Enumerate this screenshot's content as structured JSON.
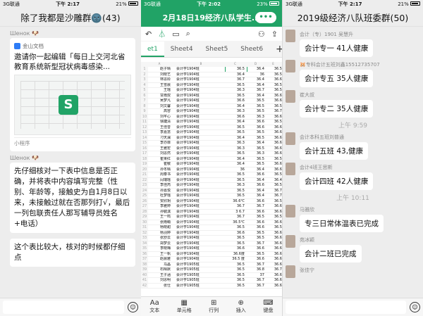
{
  "p1": {
    "status": {
      "left": "3G联通",
      "time": "下午 2:17",
      "battery": "21%"
    },
    "title": "除了我都是沙雕群🌚(43)",
    "m1": {
      "sender": "Шенок 🐶",
      "src": "金山文档",
      "ctitle": "邀请你一起编辑「每日上交河北省教育系统新型冠状病毒感染...",
      "mini": "小程序"
    },
    "m2": {
      "sender": "Шенок 🐶",
      "text": "先仔细核对一下表中信息是否正确，并将表中内容填写完整（性别、年龄等，接触史为自1月8日以来，未接触过就在否那列打√，最后一列包联责任人那写辅导员姓名+电话）"
    },
    "m3": {
      "text": "这个表比较大，核对的时候都仔细点"
    }
  },
  "p2": {
    "status": {
      "left": "3G联通",
      "time": "下午 2:02",
      "battery": "23%"
    },
    "title": "2月18日19经济八队学生...",
    "more": "•••",
    "tabs": [
      "et1",
      "Sheet4",
      "Sheet5",
      "Sheet6",
      "+"
    ],
    "cols": [
      "",
      "A",
      "B",
      "C",
      "D",
      "E",
      "F"
    ],
    "rows": [
      [
        "赵子晴",
        "会计学1904班",
        "36.5",
        "36.4",
        "36.5"
      ],
      [
        "刘晓艺",
        "会计学1904班",
        "36.4",
        "36",
        "36.5"
      ],
      [
        "林思彤",
        "会计学1904班",
        "36.7",
        "36.4",
        "36.6"
      ],
      [
        "王雪晨",
        "会计学1904班",
        "36.5",
        "36.4",
        "36.5"
      ],
      [
        "王瑶",
        "会计学1904班",
        "36.3",
        "36.7",
        "36.5"
      ],
      [
        "甘雨双",
        "会计学1904班",
        "36.5",
        "36.4",
        "36.6"
      ],
      [
        "吴梦凡",
        "会计学1904班",
        "36.6",
        "36.5",
        "36.6"
      ],
      [
        "刘文馨",
        "会计学1904班",
        "36.4",
        "36.5",
        "36.5"
      ],
      [
        "高容",
        "会计学1904班",
        "36.3",
        "36.5",
        "36.7"
      ],
      [
        "刘芊心",
        "会计学1904班",
        "36.6",
        "36.3",
        "36.6"
      ],
      [
        "徐婕清",
        "会计学1904班",
        "36.4",
        "36.6",
        "36.5"
      ],
      [
        "王佳音",
        "会计学1904班",
        "36.5",
        "36.6",
        "36.6"
      ],
      [
        "李嘉慧",
        "会计学1904班",
        "36.5",
        "36.5",
        "36.6"
      ],
      [
        "刁天澜",
        "会计学1904班",
        "36.4",
        "36.5",
        "36.6"
      ],
      [
        "李亦菲",
        "会计学1904班",
        "36.3",
        "36.4",
        "36.6"
      ],
      [
        "王雅宏",
        "会计学1904班",
        "36.3",
        "36.5",
        "36.6"
      ],
      [
        "刘思然",
        "会计学1904班",
        "36.5",
        "36.3",
        "36.6"
      ],
      [
        "崔果红",
        "会计学1904班",
        "36.4",
        "36.5",
        "36.5"
      ],
      [
        "崔敏",
        "会计学1904班",
        "36.4",
        "36.5",
        "36.6"
      ],
      [
        "孙冬晴",
        "会计学1904班",
        "36",
        "36.4",
        "36.6"
      ],
      [
        "周泰书",
        "会计学1904班",
        "36.5",
        "36.6",
        "36.5"
      ],
      [
        "闫瑞瑶",
        "会计学1904班",
        "36.5",
        "36.4",
        "36.4"
      ],
      [
        "李佳芮",
        "会计学1904班",
        "36.3",
        "36.6",
        "36.5"
      ],
      [
        "孙嘉悦",
        "会计学1904班",
        "36.5",
        "36.4",
        "36.7"
      ],
      [
        "杜梦瑶",
        "会计学1904班",
        "36.5",
        "36.4",
        "36.7"
      ],
      [
        "安欣玥",
        "会计学1904班",
        "36.6℃",
        "36.6",
        "36.5"
      ],
      [
        "李雅婷",
        "会计学1904班",
        "36.7",
        "36.7",
        "36.6"
      ],
      [
        "孙毓淇",
        "会计学1904班",
        "3 6.7",
        "36.6",
        "36.6"
      ],
      [
        "王一鸣",
        "会计学1904班",
        "36.7",
        "36.5",
        "36.5"
      ],
      [
        "张雨萌",
        "会计学1904班",
        "36.5℃",
        "36.6",
        "36.6"
      ],
      [
        "杨晓甜",
        "会计学1904班",
        "36.5",
        "36.6",
        "36.5"
      ],
      [
        "杨羽婷",
        "会计学1904班",
        "36.6",
        "36.5",
        "36.6"
      ],
      [
        "张舒云",
        "会计学1904班",
        "36.5",
        "36.5",
        "36.6"
      ],
      [
        "郑梦云",
        "会计学1904班",
        "36.5",
        "36.7",
        "36.6"
      ],
      [
        "李晓梅",
        "会计学1904班",
        "36.6",
        "36.6",
        "36.6"
      ],
      [
        "王一帆",
        "会计学1904班",
        "36.6度",
        "36.5",
        "36.6"
      ],
      [
        "赵晨雅",
        "会计学1904班",
        "36.5 度",
        "36.6",
        "36.6"
      ],
      [
        "马晶",
        "会计学1905班",
        "36.5",
        "36.7",
        "36.6"
      ],
      [
        "石晴默",
        "会计学1905班",
        "36.5",
        "36.8",
        "36.7"
      ],
      [
        "王子涵",
        "会计学1905班",
        "36.5",
        "37",
        "36.6"
      ],
      [
        "刘思明",
        "会计学1905班",
        "36.5",
        "36.7",
        "36.6"
      ],
      [
        "张仕",
        "会计学1905班",
        "36.5",
        "36.7",
        "36.6"
      ]
    ],
    "toolbar": [
      "文本",
      "单元格",
      "行列",
      "插入",
      "键盘"
    ]
  },
  "p3": {
    "status": {
      "left": "3G联通",
      "time": "下午 2:17",
      "battery": "21%"
    },
    "title": "2019级经济八队班委群(50)",
    "msgs": [
      {
        "name": "会计（专）1901 吴慧升",
        "text": "会计专一 41人健康"
      },
      {
        "name": "🐹专科会计五班刘鑫15512735707",
        "text": "会计专五 35人健康"
      },
      {
        "name": "崔大叔",
        "text": "会计专二 35人健康"
      },
      {
        "time": "上午 9:59"
      },
      {
        "name": "会计本科五班刘普通",
        "text": "会计五班 43,健康"
      },
      {
        "name": "会计4班王思斯",
        "text": "会计四班 42人健康"
      },
      {
        "time": "上午 10:11"
      },
      {
        "name": "马雅欣",
        "text": "专三日常体温表已完成"
      },
      {
        "name": "苑冰颖",
        "text": "会计二班已完成"
      },
      {
        "name": "张佳宁",
        "text": ""
      }
    ]
  }
}
